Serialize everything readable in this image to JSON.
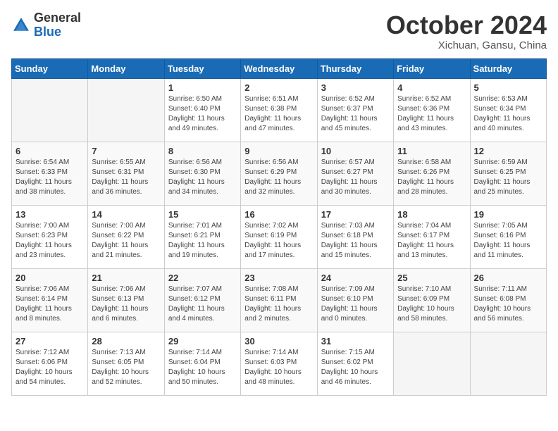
{
  "logo": {
    "general": "General",
    "blue": "Blue"
  },
  "header": {
    "month": "October 2024",
    "location": "Xichuan, Gansu, China"
  },
  "weekdays": [
    "Sunday",
    "Monday",
    "Tuesday",
    "Wednesday",
    "Thursday",
    "Friday",
    "Saturday"
  ],
  "weeks": [
    [
      {
        "day": "",
        "sunrise": "",
        "sunset": "",
        "daylight": ""
      },
      {
        "day": "",
        "sunrise": "",
        "sunset": "",
        "daylight": ""
      },
      {
        "day": "1",
        "sunrise": "Sunrise: 6:50 AM",
        "sunset": "Sunset: 6:40 PM",
        "daylight": "Daylight: 11 hours and 49 minutes."
      },
      {
        "day": "2",
        "sunrise": "Sunrise: 6:51 AM",
        "sunset": "Sunset: 6:38 PM",
        "daylight": "Daylight: 11 hours and 47 minutes."
      },
      {
        "day": "3",
        "sunrise": "Sunrise: 6:52 AM",
        "sunset": "Sunset: 6:37 PM",
        "daylight": "Daylight: 11 hours and 45 minutes."
      },
      {
        "day": "4",
        "sunrise": "Sunrise: 6:52 AM",
        "sunset": "Sunset: 6:36 PM",
        "daylight": "Daylight: 11 hours and 43 minutes."
      },
      {
        "day": "5",
        "sunrise": "Sunrise: 6:53 AM",
        "sunset": "Sunset: 6:34 PM",
        "daylight": "Daylight: 11 hours and 40 minutes."
      }
    ],
    [
      {
        "day": "6",
        "sunrise": "Sunrise: 6:54 AM",
        "sunset": "Sunset: 6:33 PM",
        "daylight": "Daylight: 11 hours and 38 minutes."
      },
      {
        "day": "7",
        "sunrise": "Sunrise: 6:55 AM",
        "sunset": "Sunset: 6:31 PM",
        "daylight": "Daylight: 11 hours and 36 minutes."
      },
      {
        "day": "8",
        "sunrise": "Sunrise: 6:56 AM",
        "sunset": "Sunset: 6:30 PM",
        "daylight": "Daylight: 11 hours and 34 minutes."
      },
      {
        "day": "9",
        "sunrise": "Sunrise: 6:56 AM",
        "sunset": "Sunset: 6:29 PM",
        "daylight": "Daylight: 11 hours and 32 minutes."
      },
      {
        "day": "10",
        "sunrise": "Sunrise: 6:57 AM",
        "sunset": "Sunset: 6:27 PM",
        "daylight": "Daylight: 11 hours and 30 minutes."
      },
      {
        "day": "11",
        "sunrise": "Sunrise: 6:58 AM",
        "sunset": "Sunset: 6:26 PM",
        "daylight": "Daylight: 11 hours and 28 minutes."
      },
      {
        "day": "12",
        "sunrise": "Sunrise: 6:59 AM",
        "sunset": "Sunset: 6:25 PM",
        "daylight": "Daylight: 11 hours and 25 minutes."
      }
    ],
    [
      {
        "day": "13",
        "sunrise": "Sunrise: 7:00 AM",
        "sunset": "Sunset: 6:23 PM",
        "daylight": "Daylight: 11 hours and 23 minutes."
      },
      {
        "day": "14",
        "sunrise": "Sunrise: 7:00 AM",
        "sunset": "Sunset: 6:22 PM",
        "daylight": "Daylight: 11 hours and 21 minutes."
      },
      {
        "day": "15",
        "sunrise": "Sunrise: 7:01 AM",
        "sunset": "Sunset: 6:21 PM",
        "daylight": "Daylight: 11 hours and 19 minutes."
      },
      {
        "day": "16",
        "sunrise": "Sunrise: 7:02 AM",
        "sunset": "Sunset: 6:19 PM",
        "daylight": "Daylight: 11 hours and 17 minutes."
      },
      {
        "day": "17",
        "sunrise": "Sunrise: 7:03 AM",
        "sunset": "Sunset: 6:18 PM",
        "daylight": "Daylight: 11 hours and 15 minutes."
      },
      {
        "day": "18",
        "sunrise": "Sunrise: 7:04 AM",
        "sunset": "Sunset: 6:17 PM",
        "daylight": "Daylight: 11 hours and 13 minutes."
      },
      {
        "day": "19",
        "sunrise": "Sunrise: 7:05 AM",
        "sunset": "Sunset: 6:16 PM",
        "daylight": "Daylight: 11 hours and 11 minutes."
      }
    ],
    [
      {
        "day": "20",
        "sunrise": "Sunrise: 7:06 AM",
        "sunset": "Sunset: 6:14 PM",
        "daylight": "Daylight: 11 hours and 8 minutes."
      },
      {
        "day": "21",
        "sunrise": "Sunrise: 7:06 AM",
        "sunset": "Sunset: 6:13 PM",
        "daylight": "Daylight: 11 hours and 6 minutes."
      },
      {
        "day": "22",
        "sunrise": "Sunrise: 7:07 AM",
        "sunset": "Sunset: 6:12 PM",
        "daylight": "Daylight: 11 hours and 4 minutes."
      },
      {
        "day": "23",
        "sunrise": "Sunrise: 7:08 AM",
        "sunset": "Sunset: 6:11 PM",
        "daylight": "Daylight: 11 hours and 2 minutes."
      },
      {
        "day": "24",
        "sunrise": "Sunrise: 7:09 AM",
        "sunset": "Sunset: 6:10 PM",
        "daylight": "Daylight: 11 hours and 0 minutes."
      },
      {
        "day": "25",
        "sunrise": "Sunrise: 7:10 AM",
        "sunset": "Sunset: 6:09 PM",
        "daylight": "Daylight: 10 hours and 58 minutes."
      },
      {
        "day": "26",
        "sunrise": "Sunrise: 7:11 AM",
        "sunset": "Sunset: 6:08 PM",
        "daylight": "Daylight: 10 hours and 56 minutes."
      }
    ],
    [
      {
        "day": "27",
        "sunrise": "Sunrise: 7:12 AM",
        "sunset": "Sunset: 6:06 PM",
        "daylight": "Daylight: 10 hours and 54 minutes."
      },
      {
        "day": "28",
        "sunrise": "Sunrise: 7:13 AM",
        "sunset": "Sunset: 6:05 PM",
        "daylight": "Daylight: 10 hours and 52 minutes."
      },
      {
        "day": "29",
        "sunrise": "Sunrise: 7:14 AM",
        "sunset": "Sunset: 6:04 PM",
        "daylight": "Daylight: 10 hours and 50 minutes."
      },
      {
        "day": "30",
        "sunrise": "Sunrise: 7:14 AM",
        "sunset": "Sunset: 6:03 PM",
        "daylight": "Daylight: 10 hours and 48 minutes."
      },
      {
        "day": "31",
        "sunrise": "Sunrise: 7:15 AM",
        "sunset": "Sunset: 6:02 PM",
        "daylight": "Daylight: 10 hours and 46 minutes."
      },
      {
        "day": "",
        "sunrise": "",
        "sunset": "",
        "daylight": ""
      },
      {
        "day": "",
        "sunrise": "",
        "sunset": "",
        "daylight": ""
      }
    ]
  ]
}
